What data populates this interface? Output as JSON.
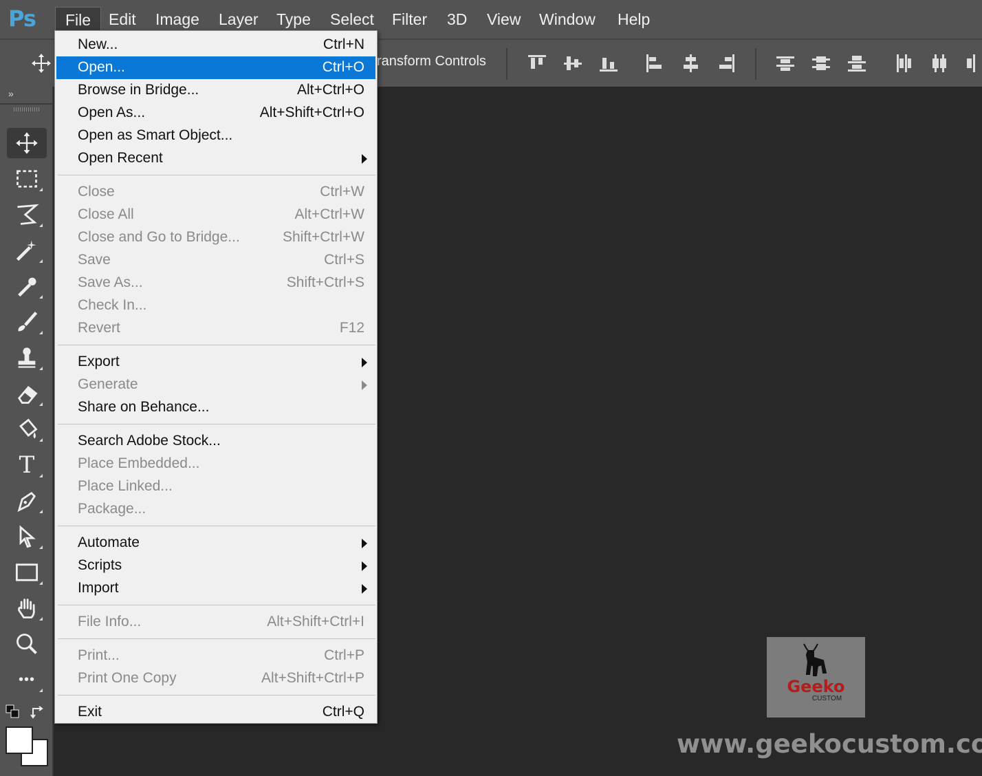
{
  "app": {
    "logo": "Ps"
  },
  "menubar": {
    "items": [
      "File",
      "Edit",
      "Image",
      "Layer",
      "Type",
      "Select",
      "Filter",
      "3D",
      "View",
      "Window",
      "Help"
    ],
    "active": "File"
  },
  "options_bar": {
    "label": "ransform Controls",
    "icons": [
      "move-icon",
      "align-top-icon",
      "align-vcenter-icon",
      "align-bottom-icon",
      "align-left-icon",
      "align-hcenter-icon",
      "align-right-icon",
      "distribute-top-icon",
      "distribute-vcenter-icon",
      "distribute-bottom-icon",
      "distribute-left-icon",
      "distribute-hcenter-icon",
      "distribute-right-icon"
    ]
  },
  "toolbox": {
    "expand": "»",
    "tools": [
      "move-tool",
      "marquee-tool",
      "lasso-tool",
      "magic-wand-tool",
      "eyedropper-tool",
      "brush-tool",
      "stamp-tool",
      "eraser-tool",
      "paint-bucket-tool",
      "type-tool",
      "pen-tool",
      "path-select-tool",
      "rectangle-tool",
      "hand-tool",
      "zoom-tool",
      "more-tools"
    ],
    "type_tool_glyph": "T",
    "more_glyph": "•••"
  },
  "file_menu": {
    "items": [
      {
        "label": "New...",
        "shortcut": "Ctrl+N"
      },
      {
        "label": "Open...",
        "shortcut": "Ctrl+O",
        "highlight": true
      },
      {
        "label": "Browse in Bridge...",
        "shortcut": "Alt+Ctrl+O"
      },
      {
        "label": "Open As...",
        "shortcut": "Alt+Shift+Ctrl+O"
      },
      {
        "label": "Open as Smart Object...",
        "shortcut": ""
      },
      {
        "label": "Open Recent",
        "shortcut": "",
        "submenu": true
      },
      {
        "sep": true
      },
      {
        "label": "Close",
        "shortcut": "Ctrl+W",
        "disabled": true
      },
      {
        "label": "Close All",
        "shortcut": "Alt+Ctrl+W",
        "disabled": true
      },
      {
        "label": "Close and Go to Bridge...",
        "shortcut": "Shift+Ctrl+W",
        "disabled": true
      },
      {
        "label": "Save",
        "shortcut": "Ctrl+S",
        "disabled": true
      },
      {
        "label": "Save As...",
        "shortcut": "Shift+Ctrl+S",
        "disabled": true
      },
      {
        "label": "Check In...",
        "shortcut": "",
        "disabled": true
      },
      {
        "label": "Revert",
        "shortcut": "F12",
        "disabled": true
      },
      {
        "sep": true
      },
      {
        "label": "Export",
        "shortcut": "",
        "submenu": true
      },
      {
        "label": "Generate",
        "shortcut": "",
        "submenu": true,
        "disabled": true
      },
      {
        "label": "Share on Behance...",
        "shortcut": ""
      },
      {
        "sep": true
      },
      {
        "label": "Search Adobe Stock...",
        "shortcut": ""
      },
      {
        "label": "Place Embedded...",
        "shortcut": "",
        "disabled": true
      },
      {
        "label": "Place Linked...",
        "shortcut": "",
        "disabled": true
      },
      {
        "label": "Package...",
        "shortcut": "",
        "disabled": true
      },
      {
        "sep": true
      },
      {
        "label": "Automate",
        "shortcut": "",
        "submenu": true
      },
      {
        "label": "Scripts",
        "shortcut": "",
        "submenu": true
      },
      {
        "label": "Import",
        "shortcut": "",
        "submenu": true
      },
      {
        "sep": true
      },
      {
        "label": "File Info...",
        "shortcut": "Alt+Shift+Ctrl+I",
        "disabled": true
      },
      {
        "sep": true
      },
      {
        "label": "Print...",
        "shortcut": "Ctrl+P",
        "disabled": true
      },
      {
        "label": "Print One Copy",
        "shortcut": "Alt+Shift+Ctrl+P",
        "disabled": true
      },
      {
        "sep": true
      },
      {
        "label": "Exit",
        "shortcut": "Ctrl+Q"
      }
    ]
  },
  "watermark": {
    "brand": "Geeko",
    "brand_sub": "CUSTOM",
    "website": "www.geekocustom.com"
  },
  "colors": {
    "highlight": "#0a78d7",
    "menubar_bg": "#535353",
    "canvas_bg": "#282828",
    "ps_logo": "#4aa5d8"
  }
}
